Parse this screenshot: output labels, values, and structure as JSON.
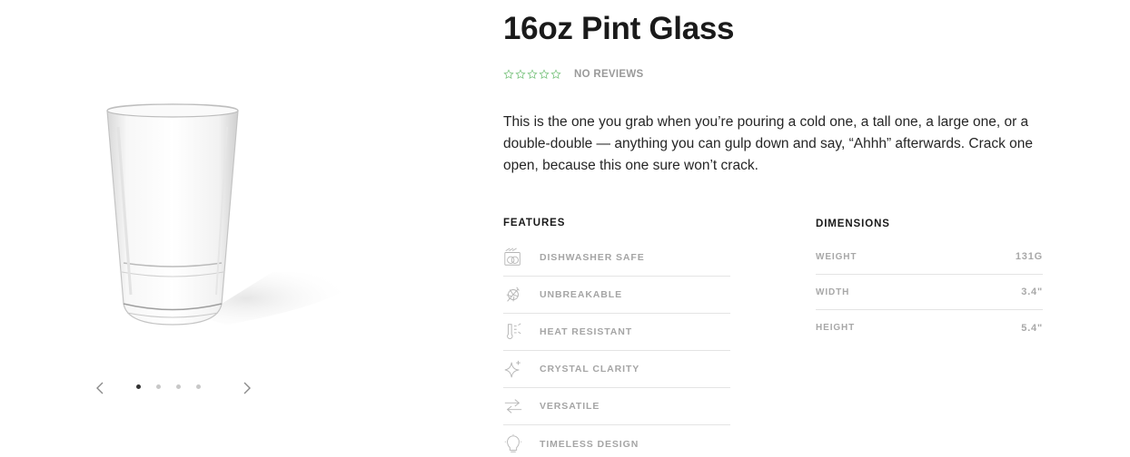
{
  "product": {
    "title": "16oz Pint Glass",
    "rating": 0,
    "rating_max": 5,
    "reviews_label": "NO REVIEWS",
    "description": "This is the one you grab when you’re pouring a cold one, a tall one, a large one, or a double-double — anything you can gulp down and say, “Ahhh” afterwards. Crack one open, because this one sure won’t crack."
  },
  "gallery": {
    "image_alt": "pint-glass-photo",
    "slide_count": 4,
    "active_slide": 1,
    "prev_icon": "chevron-left-icon",
    "next_icon": "chevron-right-icon"
  },
  "features": {
    "heading": "FEATURES",
    "items": [
      {
        "label": "DISHWASHER SAFE",
        "icon": "dishwasher-icon"
      },
      {
        "label": "UNBREAKABLE",
        "icon": "shatter-icon"
      },
      {
        "label": "HEAT RESISTANT",
        "icon": "thermometer-icon"
      },
      {
        "label": "CRYSTAL CLARITY",
        "icon": "sparkle-icon"
      },
      {
        "label": "VERSATILE",
        "icon": "arrows-icon"
      },
      {
        "label": "TIMELESS DESIGN",
        "icon": "lightbulb-icon"
      }
    ]
  },
  "dimensions": {
    "heading": "DIMENSIONS",
    "rows": [
      {
        "label": "WEIGHT",
        "value": "131G"
      },
      {
        "label": "WIDTH",
        "value": "3.4\""
      },
      {
        "label": "HEIGHT",
        "value": "5.4\""
      }
    ]
  },
  "colors": {
    "star": "#7bc47f",
    "muted_text": "#a5a5a5",
    "divider": "#e4e4e4",
    "dot_active": "#333333",
    "dot_inactive": "#c8c8c8"
  }
}
